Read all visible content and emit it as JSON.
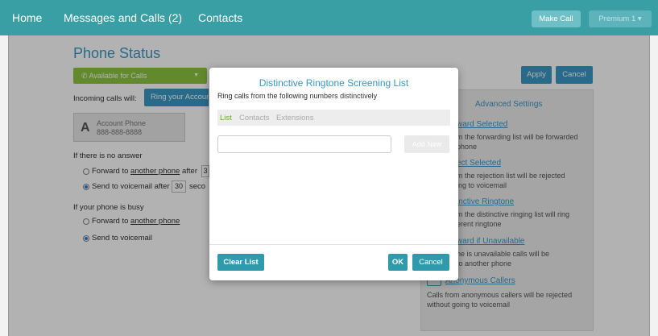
{
  "nav": {
    "home": "Home",
    "messages": "Messages and Calls (2)",
    "contacts": "Contacts",
    "make_call": "Make Call",
    "premium": "Premium 1 ▾"
  },
  "page": {
    "title": "Phone Status",
    "status_value": "Available for Calls",
    "incoming_label": "Incoming calls will:",
    "ring_button": "Ring your Account",
    "account_letter": "A",
    "account_label": "Account Phone",
    "account_number": "888-888-8888",
    "no_answer_label": "If there is no answer",
    "forward_prefix": "Forward to",
    "another_phone": "another phone",
    "after_word": "after",
    "forward_seconds": "3",
    "voicemail_prefix": "Send to voicemail after",
    "voicemail_seconds": "30",
    "seconds_word": "seco",
    "busy_label": "If your phone is busy",
    "busy_forward_prefix": "Forward to",
    "busy_another_phone": "another phone",
    "busy_voicemail": "Send to voicemail",
    "apply": "Apply",
    "cancel": "Cancel"
  },
  "advanced": {
    "title": "Advanced Settings",
    "items": [
      {
        "head": "ward Selected",
        "lines": [
          "m the forwarding list will be forwarded",
          "phone"
        ]
      },
      {
        "head": "ect Selected",
        "lines": [
          "m the rejection list will be rejected",
          "ing to voicemail"
        ]
      },
      {
        "head": "inctive Ringtone",
        "lines": [
          "m the distinctive ringing list will ring",
          "erent ringtone"
        ]
      },
      {
        "head": "ward if Unavailable",
        "lines": [
          "ne is unavailable calls will be",
          "to another phone"
        ]
      },
      {
        "head": "Anonymous Callers",
        "lines": [
          "Calls from anonymous callers will be rejected",
          "without going to voicemail"
        ]
      }
    ]
  },
  "modal": {
    "title": "Distinctive Ringtone Screening List",
    "subtitle": "Ring calls from the following numbers distinctively",
    "tabs": [
      "List",
      "Contacts",
      "Extensions"
    ],
    "input_value": "",
    "add_new": "Add New",
    "clear_list": "Clear List",
    "ok": "OK",
    "cancel": "Cancel"
  },
  "colors": {
    "nav_bg": "#3a9ea5",
    "accent_blue": "#3a98c6",
    "status_green": "#8dc63f",
    "modal_button": "#2e9aab"
  }
}
